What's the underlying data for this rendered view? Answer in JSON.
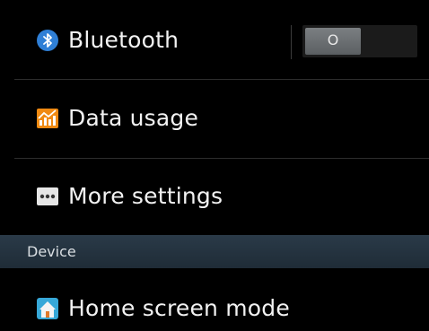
{
  "settings": {
    "items": [
      {
        "label": "Bluetooth",
        "icon": "bluetooth-icon"
      },
      {
        "label": "Data usage",
        "icon": "data-usage-icon"
      },
      {
        "label": "More settings",
        "icon": "more-settings-icon"
      }
    ],
    "section": {
      "label": "Device"
    },
    "device_items": [
      {
        "label": "Home screen mode",
        "icon": "home-screen-icon"
      }
    ]
  },
  "bluetooth_toggle": {
    "state": "off",
    "knob_text": "O"
  },
  "colors": {
    "background": "#000000",
    "section_header": "#26343f",
    "toggle_knob": "#6b6f72",
    "bluetooth_blue": "#2f7fd6",
    "data_orange": "#f08a12",
    "home_teal": "#37a8d8"
  }
}
